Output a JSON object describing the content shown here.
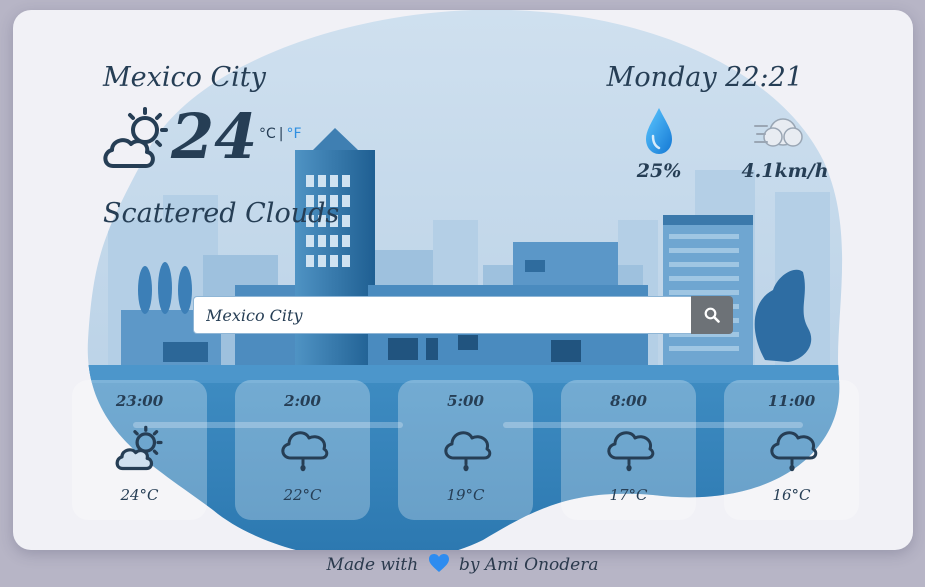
{
  "current": {
    "city": "Mexico City",
    "datetime": "Monday 22:21",
    "temperature": "24",
    "unit_celsius": "°C",
    "unit_separator": "|",
    "unit_fahrenheit": "°F",
    "description": "Scattered Clouds",
    "icon": "partly-cloudy-icon",
    "humidity": "25%",
    "humidity_icon": "water-drop-icon",
    "wind": "4.1km/h",
    "wind_icon": "wind-icon"
  },
  "search": {
    "value": "Mexico City",
    "button_icon": "search-icon"
  },
  "forecast": [
    {
      "time": "23:00",
      "temp": "24°C",
      "icon": "partly-cloudy-icon"
    },
    {
      "time": "2:00",
      "temp": "22°C",
      "icon": "rain-cloud-icon"
    },
    {
      "time": "5:00",
      "temp": "19°C",
      "icon": "rain-cloud-icon"
    },
    {
      "time": "8:00",
      "temp": "17°C",
      "icon": "rain-cloud-icon"
    },
    {
      "time": "11:00",
      "temp": "16°C",
      "icon": "rain-cloud-icon"
    }
  ],
  "footer": {
    "prefix": "Made with",
    "suffix": "by Ami Onodera",
    "heart_icon": "blue-heart-icon"
  },
  "colors": {
    "background": "#b7b5c6",
    "card": "#f1f1f6",
    "text": "#263e55",
    "accent": "#2f8fe0"
  }
}
